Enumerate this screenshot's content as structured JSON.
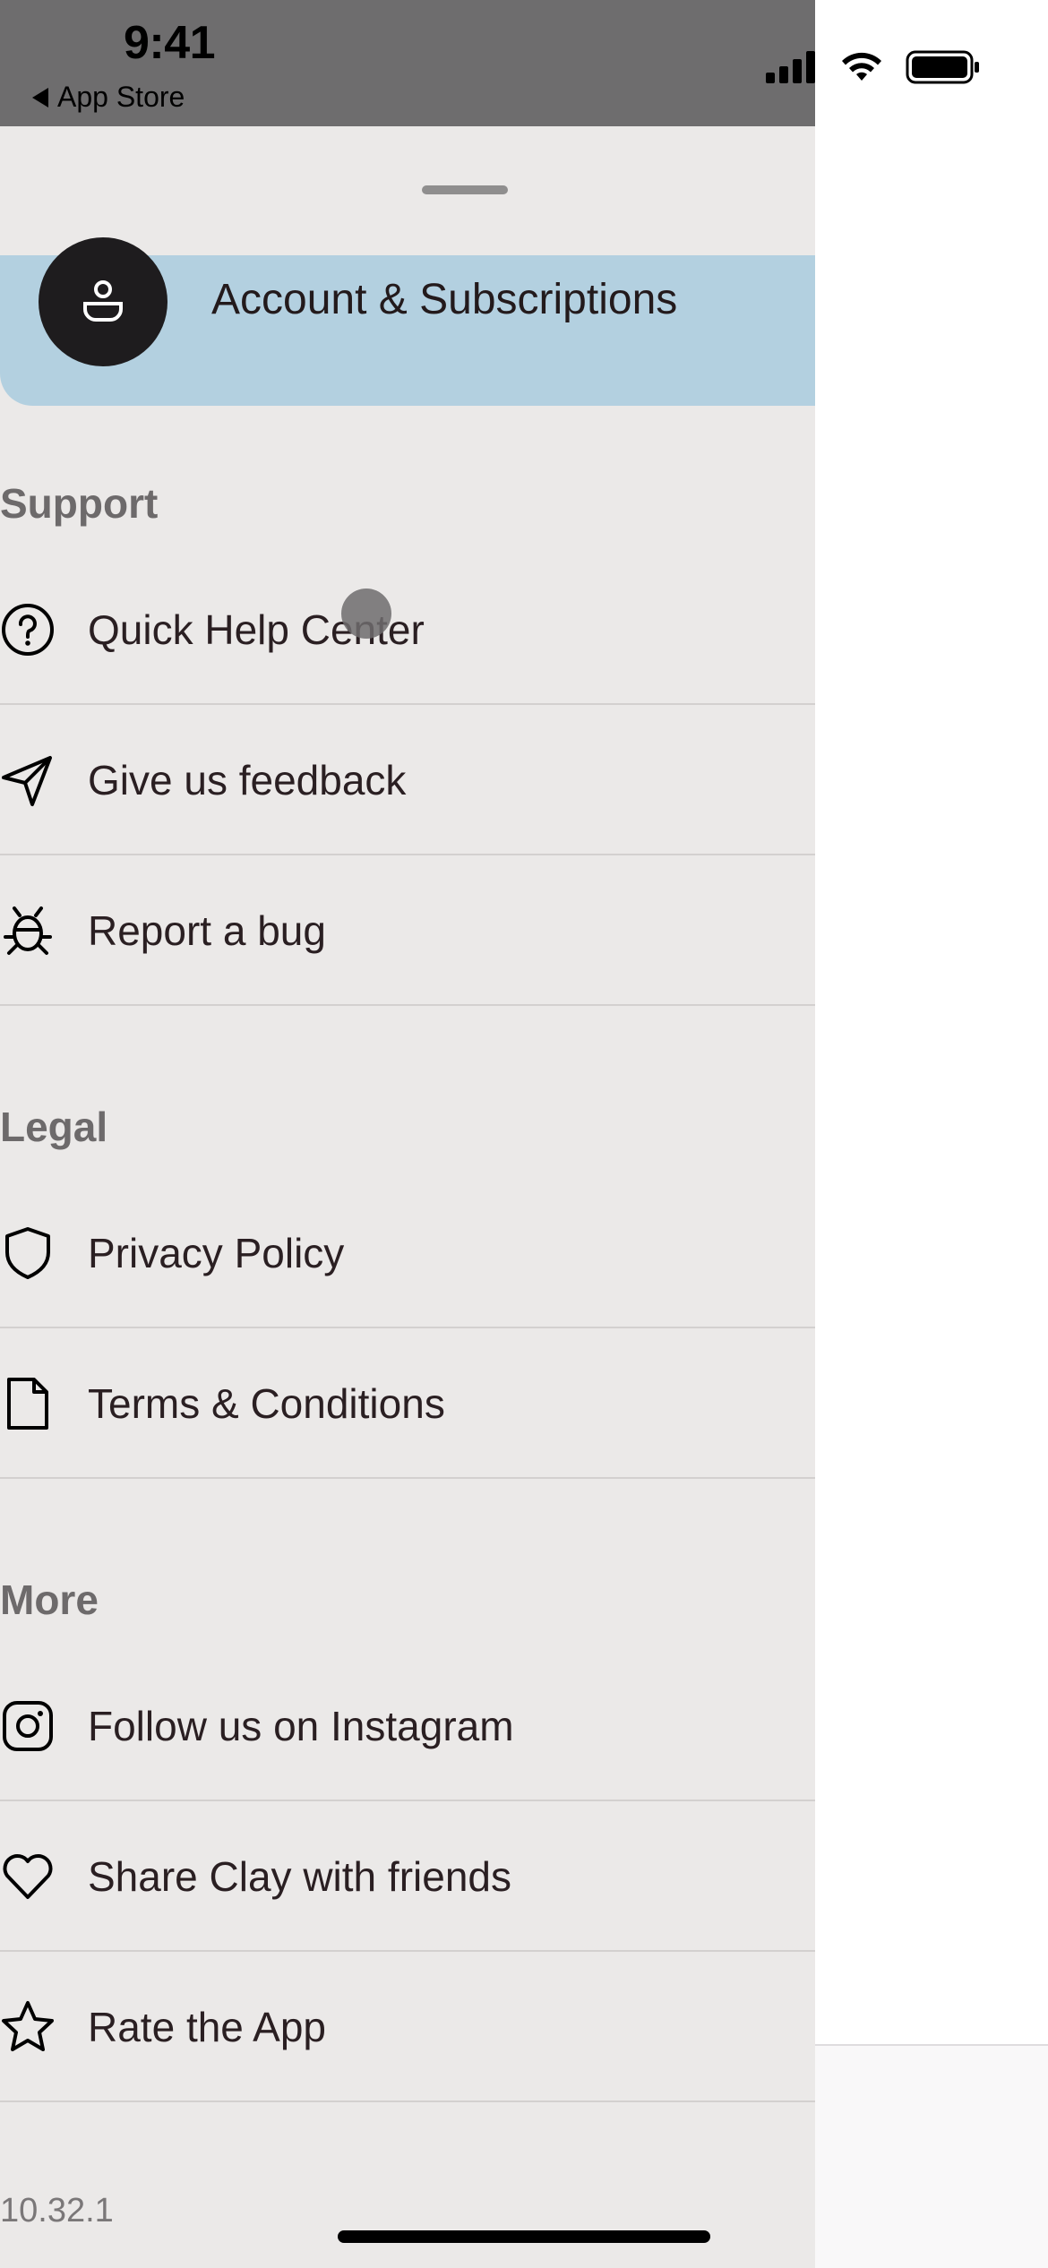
{
  "status_bar": {
    "time": "9:41",
    "back_label": "App Store"
  },
  "account": {
    "label": "Account & Subscriptions"
  },
  "sections": {
    "support": {
      "title": "Support",
      "items": [
        {
          "label": "Quick Help Center",
          "icon": "question-circle-icon"
        },
        {
          "label": "Give us feedback",
          "icon": "send-icon"
        },
        {
          "label": "Report a bug",
          "icon": "bug-icon"
        }
      ]
    },
    "legal": {
      "title": "Legal",
      "items": [
        {
          "label": "Privacy Policy",
          "icon": "shield-icon"
        },
        {
          "label": "Terms & Conditions",
          "icon": "document-icon"
        }
      ]
    },
    "more": {
      "title": "More",
      "items": [
        {
          "label": "Follow us on Instagram",
          "icon": "instagram-icon"
        },
        {
          "label": "Share Clay with friends",
          "icon": "heart-icon"
        },
        {
          "label": "Rate the App",
          "icon": "star-icon"
        }
      ]
    }
  },
  "version": "10.32.1",
  "colors": {
    "drawer_bg": "#ebe9e8",
    "account_card": "#b3d0e0",
    "avatar": "#1e1c1e",
    "text": "#2a1f22",
    "section_title": "#6d6a6b"
  }
}
